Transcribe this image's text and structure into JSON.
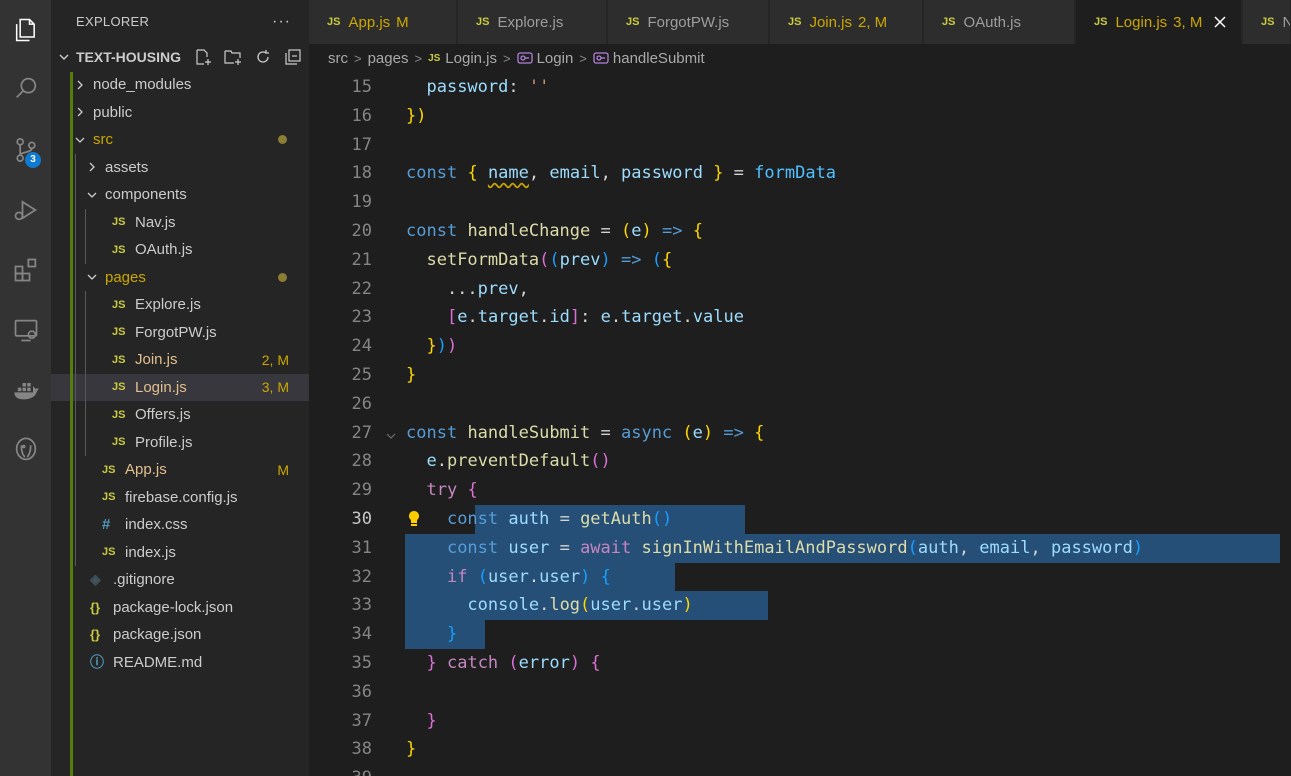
{
  "explorer": {
    "title": "EXPLORER",
    "more": "···",
    "project": "TEXT-HOUSING",
    "tree": [
      {
        "name": "node_modules",
        "type": "folder",
        "open": false,
        "depth": 0,
        "status": "",
        "modified": false
      },
      {
        "name": "public",
        "type": "folder",
        "open": false,
        "depth": 0,
        "status": "",
        "modified": false
      },
      {
        "name": "src",
        "type": "folder",
        "open": true,
        "depth": 0,
        "status": "dot",
        "modified": true
      },
      {
        "name": "assets",
        "type": "folder",
        "open": false,
        "depth": 1,
        "status": "",
        "modified": false
      },
      {
        "name": "components",
        "type": "folder",
        "open": true,
        "depth": 1,
        "status": "",
        "modified": false
      },
      {
        "name": "Nav.js",
        "type": "js",
        "depth": 2,
        "status": "",
        "modified": false
      },
      {
        "name": "OAuth.js",
        "type": "js",
        "depth": 2,
        "status": "",
        "modified": false
      },
      {
        "name": "pages",
        "type": "folder",
        "open": true,
        "depth": 1,
        "status": "dot",
        "modified": true
      },
      {
        "name": "Explore.js",
        "type": "js",
        "depth": 2,
        "status": "",
        "modified": false
      },
      {
        "name": "ForgotPW.js",
        "type": "js",
        "depth": 2,
        "status": "",
        "modified": false
      },
      {
        "name": "Join.js",
        "type": "js",
        "depth": 2,
        "status": "2, M",
        "modified": true
      },
      {
        "name": "Login.js",
        "type": "js",
        "depth": 2,
        "status": "3, M",
        "modified": true,
        "active": true
      },
      {
        "name": "Offers.js",
        "type": "js",
        "depth": 2,
        "status": "",
        "modified": false
      },
      {
        "name": "Profile.js",
        "type": "js",
        "depth": 2,
        "status": "",
        "modified": false
      },
      {
        "name": "App.js",
        "type": "js",
        "depth": 1,
        "status": "M",
        "modified": true
      },
      {
        "name": "firebase.config.js",
        "type": "js",
        "depth": 1,
        "status": "",
        "modified": false
      },
      {
        "name": "index.css",
        "type": "css",
        "depth": 1,
        "status": "",
        "modified": false
      },
      {
        "name": "index.js",
        "type": "js",
        "depth": 1,
        "status": "",
        "modified": false
      },
      {
        "name": ".gitignore",
        "type": "git",
        "depth": 0,
        "status": "",
        "modified": false
      },
      {
        "name": "package-lock.json",
        "type": "json",
        "depth": 0,
        "status": "",
        "modified": false
      },
      {
        "name": "package.json",
        "type": "json",
        "depth": 0,
        "status": "",
        "modified": false
      },
      {
        "name": "README.md",
        "type": "info",
        "depth": 0,
        "status": "",
        "modified": false
      }
    ]
  },
  "activity": {
    "scm_badge": "3",
    "icons": [
      "explorer-icon",
      "search-icon",
      "source-control-icon",
      "run-debug-icon",
      "extensions-icon",
      "remote-explorer-icon",
      "docker-icon",
      "database-icon"
    ]
  },
  "tabs": [
    {
      "label": "App.js",
      "status": "M",
      "modified": true,
      "active": false
    },
    {
      "label": "Explore.js",
      "status": "",
      "modified": false,
      "active": false
    },
    {
      "label": "ForgotPW.js",
      "status": "",
      "modified": false,
      "active": false
    },
    {
      "label": "Join.js",
      "status": "2, M",
      "modified": true,
      "active": false
    },
    {
      "label": "OAuth.js",
      "status": "",
      "modified": false,
      "active": false
    },
    {
      "label": "Login.js",
      "status": "3, M",
      "modified": true,
      "active": true
    },
    {
      "label": "N",
      "status": "",
      "modified": false,
      "active": false
    }
  ],
  "file_badge": "JS",
  "breadcrumb": [
    "src",
    "pages",
    "Login.js",
    "Login",
    "handleSubmit"
  ],
  "editor": {
    "current_line": 30,
    "lines": [
      {
        "n": 15,
        "text": "    password: ''"
      },
      {
        "n": 16,
        "text": "  })"
      },
      {
        "n": 17,
        "text": ""
      },
      {
        "n": 18,
        "text": "  const { name, email, password } = formData"
      },
      {
        "n": 19,
        "text": ""
      },
      {
        "n": 20,
        "text": "  const handleChange = (e) => {"
      },
      {
        "n": 21,
        "text": "    setFormData((prev) => ({"
      },
      {
        "n": 22,
        "text": "      ...prev,"
      },
      {
        "n": 23,
        "text": "      [e.target.id]: e.target.value"
      },
      {
        "n": 24,
        "text": "    }))"
      },
      {
        "n": 25,
        "text": "  }"
      },
      {
        "n": 26,
        "text": ""
      },
      {
        "n": 27,
        "text": "  const handleSubmit = async (e) => {"
      },
      {
        "n": 28,
        "text": "    e.preventDefault()"
      },
      {
        "n": 29,
        "text": "    try {"
      },
      {
        "n": 30,
        "text": "      const auth = getAuth()"
      },
      {
        "n": 31,
        "text": "      const user = await signInWithEmailAndPassword(auth, email, password)"
      },
      {
        "n": 32,
        "text": "      if (user.user) {"
      },
      {
        "n": 33,
        "text": "        console.log(user.user)"
      },
      {
        "n": 34,
        "text": "      }"
      },
      {
        "n": 35,
        "text": "    } catch (error) {"
      },
      {
        "n": 36,
        "text": ""
      },
      {
        "n": 37,
        "text": "    }"
      },
      {
        "n": 38,
        "text": "  }"
      },
      {
        "n": 39,
        "text": ""
      }
    ]
  },
  "colors": {
    "accent": "#0e7ad1",
    "modified": "#cca700",
    "selection": "#264f78",
    "git_added": "#587c0c"
  }
}
